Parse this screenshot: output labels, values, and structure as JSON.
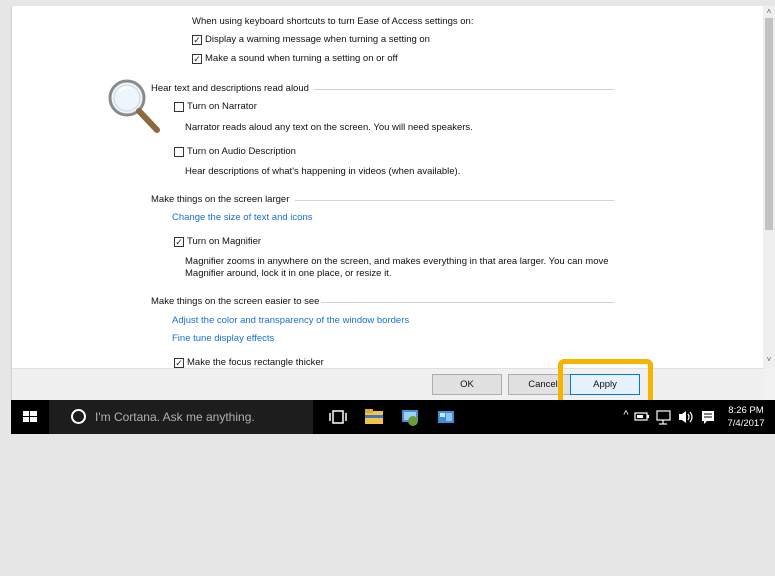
{
  "settings": {
    "keyboard_shortcuts_heading": "When using keyboard shortcuts to turn Ease of Access settings on:",
    "warning_message_label": "Display a warning message when turning a setting on",
    "sound_label": "Make a sound when turning a setting on or off",
    "section_read_aloud": "Hear text and descriptions read aloud",
    "narrator_label": "Turn on Narrator",
    "narrator_desc": "Narrator reads aloud any text on the screen. You will need speakers.",
    "audio_desc_label": "Turn on Audio Description",
    "audio_desc_desc": "Hear descriptions of what's happening in videos (when available).",
    "section_larger": "Make things on the screen larger",
    "change_size_link": "Change the size of text and icons",
    "magnifier_label": "Turn on Magnifier",
    "magnifier_desc_1": "Magnifier zooms in anywhere on the screen, and makes everything in that area larger. You can move",
    "magnifier_desc_2": "Magnifier around, lock it in one place, or resize it.",
    "section_easier": "Make things on the screen easier to see",
    "adjust_color_link": "Adjust the color and transparency of the window borders",
    "fine_tune_link": "Fine tune display effects",
    "focus_rect_label": "Make the focus rectangle thicker"
  },
  "checkboxes": {
    "warning_message": true,
    "sound": true,
    "narrator": false,
    "audio_description": false,
    "magnifier": true,
    "focus_rectangle": true
  },
  "buttons": {
    "ok": "OK",
    "cancel": "Cancel",
    "apply": "Apply"
  },
  "taskbar": {
    "search_placeholder": "I'm Cortana. Ask me anything.",
    "time": "8:26 PM",
    "date": "7/4/2017"
  },
  "colors": {
    "link": "#1a6fd0",
    "highlight": "#f5b400",
    "taskbar": "#000000"
  },
  "icons": [
    "magnifier-icon",
    "windows-logo-icon",
    "cortana-icon",
    "task-view-icon",
    "file-explorer-icon",
    "control-panel-icon",
    "app-icon",
    "chevron-up-icon",
    "battery-icon",
    "network-icon",
    "volume-icon",
    "action-center-icon"
  ]
}
